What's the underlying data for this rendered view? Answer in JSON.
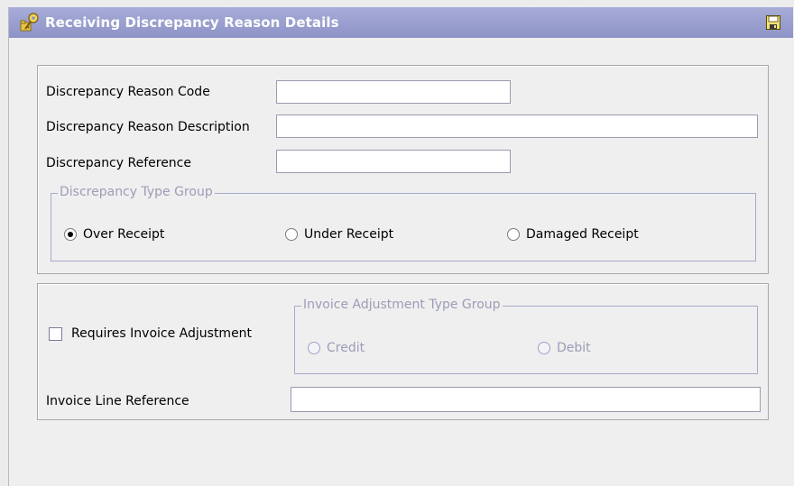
{
  "window": {
    "title": "Receiving Discrepancy Reason Details",
    "title_icon": "key-folder-icon",
    "save_icon": "floppy-disk-icon"
  },
  "form": {
    "reason_code_label": "Discrepancy Reason Code",
    "reason_code_value": "",
    "reason_description_label": "Discrepancy Reason Description",
    "reason_description_value": "",
    "reference_label": "Discrepancy Reference",
    "reference_value": ""
  },
  "type_group": {
    "legend": "Discrepancy Type Group",
    "options": [
      {
        "label": "Over Receipt",
        "checked": true
      },
      {
        "label": "Under Receipt",
        "checked": false
      },
      {
        "label": "Damaged Receipt",
        "checked": false
      }
    ]
  },
  "invoice": {
    "requires_adjustment_label": "Requires Invoice Adjustment",
    "requires_adjustment_checked": false,
    "adjustment_group_legend": "Invoice Adjustment Type Group",
    "adjustment_options": [
      {
        "label": "Credit",
        "enabled": false
      },
      {
        "label": "Debit",
        "enabled": false
      }
    ],
    "line_reference_label": "Invoice Line Reference",
    "line_reference_value": ""
  },
  "colors": {
    "titlebar": "#9da2d2",
    "disabled_text": "#9c9cb8",
    "group_border": "#a6aacb"
  }
}
